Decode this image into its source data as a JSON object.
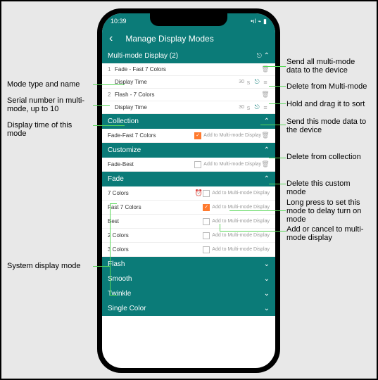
{
  "status": {
    "time": "10:39"
  },
  "header": {
    "back": "‹",
    "title": "Manage Display Modes"
  },
  "multi": {
    "title": "Multi-mode Display (2)",
    "items": [
      {
        "sn": "1",
        "name": "Fade - Fast 7 Colors",
        "dt_label": "Display Time",
        "dt_val": "30"
      },
      {
        "sn": "2",
        "name": "Flash - 7 Colors",
        "dt_label": "Display Time",
        "dt_val": "30"
      }
    ]
  },
  "collection": {
    "title": "Collection",
    "item": "Fade-Fast 7 Colors",
    "add": "Add to Multi-mode Display"
  },
  "customize": {
    "title": "Customize",
    "item": "Fade-Best",
    "add": "Add to Multi-mode Display"
  },
  "fade": {
    "title": "Fade",
    "add": "Add to Multi-mode Display",
    "items": [
      "7 Colors",
      "Fast 7 Colors",
      "Best",
      "2 Colors",
      "3 Colors"
    ]
  },
  "more": [
    "Flash",
    "Smooth",
    "Twinkle",
    "Single Color"
  ],
  "ann": {
    "a1": "Mode type and name",
    "a2": "Serial number in multi-mode, up to 10",
    "a3": "Display time of this mode",
    "a4": "System display mode",
    "b1": "Send all multi-mode data to the device",
    "b2": "Delete from Multi-mode",
    "b3": "Hold and drag it to sort",
    "b4": "Send this mode data to the device",
    "b5": "Delete from collection",
    "b6": "Delete this custom mode",
    "b7": "Long press to set this mode to delay turn on mode",
    "b8": "Add or cancel to multi-mode display",
    "chev_down": "⌄",
    "chev_up": "⌃"
  }
}
